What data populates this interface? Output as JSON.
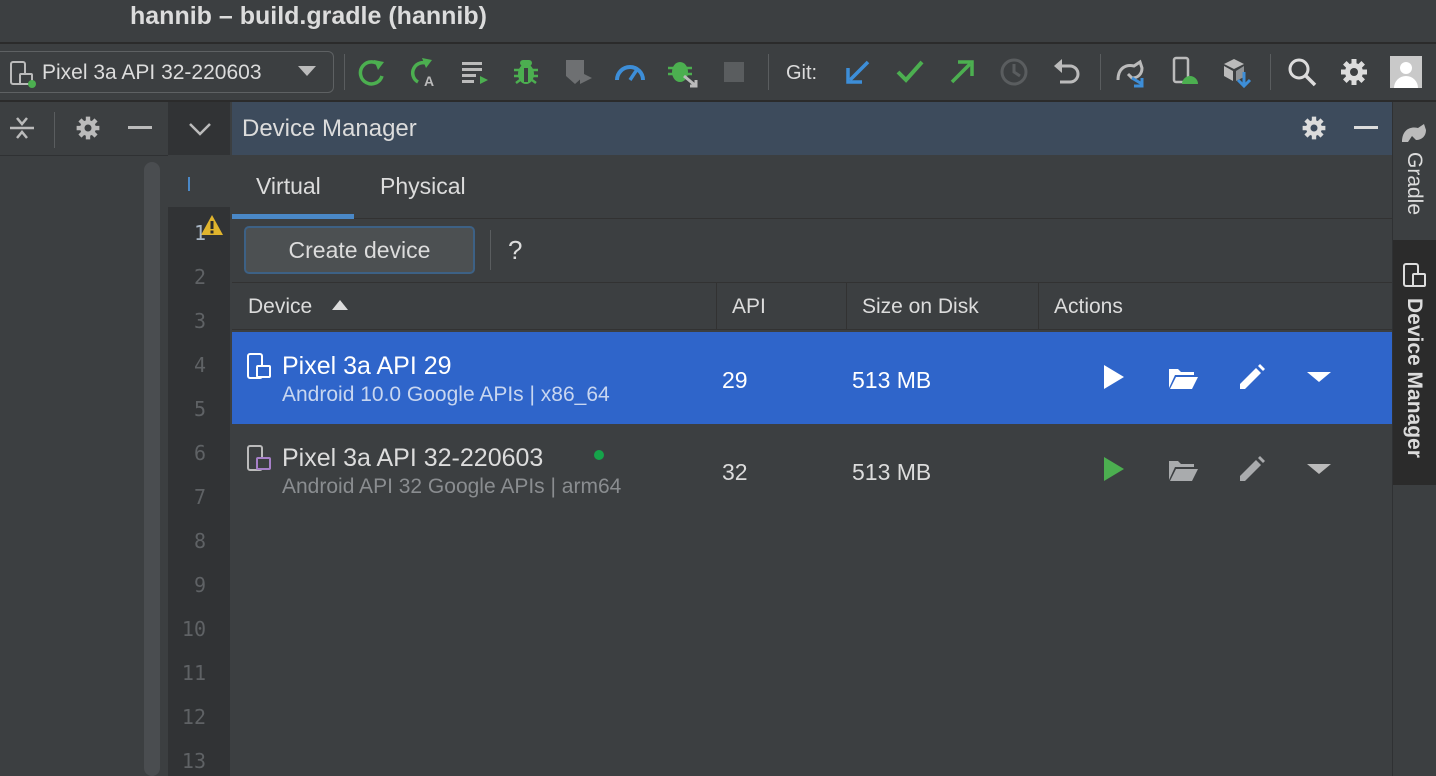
{
  "window": {
    "title": "hannib – build.gradle (hannib)"
  },
  "toolbar": {
    "device_selector": "Pixel 3a API 32-220603",
    "git_label": "Git:",
    "icons": [
      "sync-icon",
      "apply-changes-icon",
      "run-config-icon",
      "debug-icon",
      "coverage-icon",
      "profile-icon",
      "attach-debugger-icon",
      "stop-icon",
      "git-update-icon",
      "git-commit-icon",
      "git-push-icon",
      "history-icon",
      "rollback-icon",
      "gradle-sync-icon",
      "device-manager-icon",
      "sdk-manager-icon",
      "search-icon",
      "settings-icon",
      "avatar"
    ]
  },
  "editor": {
    "line_numbers": [
      "1",
      "2",
      "3",
      "4",
      "5",
      "6",
      "7",
      "8",
      "9",
      "10",
      "11",
      "12",
      "13"
    ],
    "warning_icon": "warning-icon"
  },
  "device_manager": {
    "title": "Device Manager",
    "tabs": [
      {
        "label": "Virtual",
        "active": true
      },
      {
        "label": "Physical",
        "active": false
      }
    ],
    "create_button": "Create device",
    "help": "?",
    "columns": [
      "Device",
      "API",
      "Size on Disk",
      "Actions"
    ],
    "devices": [
      {
        "name": "Pixel 3a API 29",
        "subtitle": "Android 10.0 Google APIs | x86_64",
        "api": "29",
        "size": "513 MB",
        "selected": true,
        "online": false
      },
      {
        "name": "Pixel 3a API 32-220603",
        "subtitle": "Android API 32 Google APIs | arm64",
        "api": "32",
        "size": "513 MB",
        "selected": false,
        "online": true
      }
    ],
    "actions": [
      "play-icon",
      "folder-open-icon",
      "edit-icon",
      "more-dropdown-icon"
    ]
  },
  "right_strip": {
    "items": [
      "Gradle",
      "Device Manager"
    ]
  },
  "colors": {
    "selection": "#2f65ca",
    "accent_tab": "#4a88c7",
    "run_green": "#4caf50",
    "online_dot": "#16a34a",
    "header_bg": "#3d4b5c"
  }
}
